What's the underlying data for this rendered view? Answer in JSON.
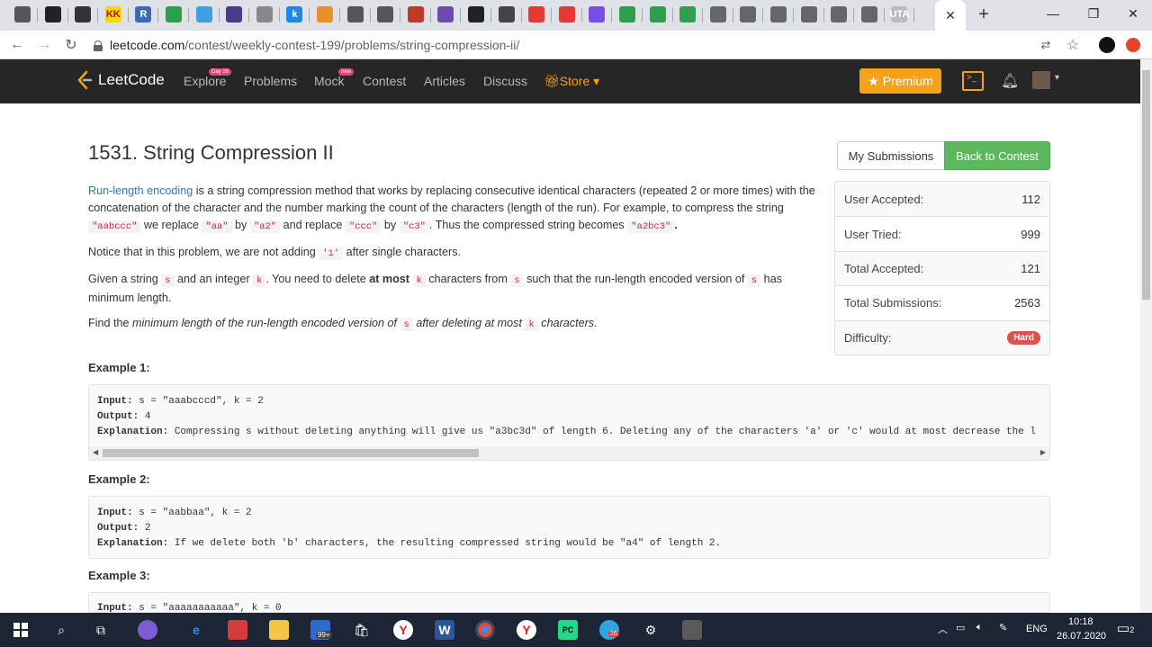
{
  "browser": {
    "tabs": [
      {
        "icon": "reader-icon",
        "label": ""
      },
      {
        "icon": "notion-icon",
        "label": ""
      },
      {
        "icon": "bow-tie-icon",
        "label": ""
      },
      {
        "icon": "kk-icon",
        "label": "KK"
      },
      {
        "icon": "r-icon",
        "label": "R"
      },
      {
        "icon": "check-circle-icon",
        "label": ""
      },
      {
        "icon": "cube-icon",
        "label": ""
      },
      {
        "icon": "hash-icon",
        "label": ""
      },
      {
        "icon": "compass-icon",
        "label": ""
      },
      {
        "icon": "k-icon",
        "label": "k"
      },
      {
        "icon": "chart-icon",
        "label": ""
      },
      {
        "icon": "globe-icon",
        "label": ""
      },
      {
        "icon": "globe-icon",
        "label": ""
      },
      {
        "icon": "image-icon",
        "label": ""
      },
      {
        "icon": "puzzle-icon",
        "label": ""
      },
      {
        "icon": "github-icon",
        "label": ""
      },
      {
        "icon": "t-circle-icon",
        "label": ""
      },
      {
        "icon": "red-box-icon",
        "label": ""
      },
      {
        "icon": "red-box-icon",
        "label": ""
      },
      {
        "icon": "kotlin-icon",
        "label": ""
      },
      {
        "icon": "q-icon",
        "label": ""
      },
      {
        "icon": "q-icon",
        "label": ""
      },
      {
        "icon": "q-icon",
        "label": ""
      },
      {
        "icon": "globe-icon",
        "label": ""
      },
      {
        "icon": "globe-icon",
        "label": ""
      },
      {
        "icon": "globe-icon",
        "label": ""
      },
      {
        "icon": "globe-icon",
        "label": ""
      },
      {
        "icon": "globe-icon",
        "label": ""
      },
      {
        "icon": "globe-icon",
        "label": ""
      },
      {
        "icon": "uta-icon",
        "label": "UTA"
      }
    ],
    "active_tab_close": "✕",
    "new_tab": "+",
    "url_host": "leetcode.com",
    "url_path": "/contest/weekly-contest-199/problems/string-compression-ii/"
  },
  "nav": {
    "logo": "LeetCode",
    "items": [
      {
        "label": "Explore",
        "badge": "Day 26"
      },
      {
        "label": "Problems",
        "badge": ""
      },
      {
        "label": "Mock",
        "badge": "new"
      },
      {
        "label": "Contest",
        "badge": ""
      },
      {
        "label": "Articles",
        "badge": ""
      },
      {
        "label": "Discuss",
        "badge": ""
      }
    ],
    "store": "Store",
    "premium": "Premium"
  },
  "problem": {
    "title": "1531. String Compression II",
    "p1": {
      "link": "Run-length encoding",
      "t1": " is a string compression method that works by replacing consecutive identical characters (repeated 2 or more times) with the concatenation of the character and the number marking the count of the characters (length of the run). For example, to compress the string ",
      "c1": "\"aabccc\"",
      "t2": " we replace ",
      "c2": "\"aa\"",
      "t3": " by ",
      "c3": "\"a2\"",
      "t4": " and replace ",
      "c4": "\"ccc\"",
      "t5": " by ",
      "c5": "\"c3\"",
      "t6": ". Thus the compressed string becomes ",
      "c6": "\"a2bc3\"",
      "t7": "."
    },
    "p2": {
      "t1": "Notice that in this problem, we are not adding ",
      "c1": "'1'",
      "t2": " after single characters."
    },
    "p3": {
      "t1": "Given a string ",
      "c1": "s",
      "t2": " and an integer ",
      "c2": "k",
      "t3": ". You need to delete ",
      "b1": "at most",
      "t4": " ",
      "c3": "k",
      "t5": " characters from ",
      "c4": "s",
      "t6": " such that the run-length encoded version of ",
      "c5": "s",
      "t7": " has minimum length."
    },
    "p4": {
      "t1": "Find the ",
      "i1": "minimum length of the run-length encoded version of ",
      "c1": "s",
      "i2": " after deleting at most ",
      "c2": "k",
      "i3": " characters."
    }
  },
  "sidebar": {
    "my_submissions": "My Submissions",
    "back_to_contest": "Back to Contest",
    "stats": [
      {
        "label": "User Accepted:",
        "value": "112"
      },
      {
        "label": "User Tried:",
        "value": "999"
      },
      {
        "label": "Total Accepted:",
        "value": "121"
      },
      {
        "label": "Total Submissions:",
        "value": "2563"
      }
    ],
    "difficulty_label": "Difficulty:",
    "difficulty_value": "Hard"
  },
  "examples": [
    {
      "heading": "Example 1:",
      "input_label": "Input:",
      "input": " s = \"aaabcccd\", k = 2",
      "output_label": "Output:",
      "output": " 4",
      "expl_label": "Explanation:",
      "expl": " Compressing s without deleting anything will give us \"a3bc3d\" of length 6. Deleting any of the characters 'a' or 'c' would at most decrease the l"
    },
    {
      "heading": "Example 2:",
      "input_label": "Input:",
      "input": " s = \"aabbaa\", k = 2",
      "output_label": "Output:",
      "output": " 2",
      "expl_label": "Explanation:",
      "expl": " If we delete both 'b' characters, the resulting compressed string would be \"a4\" of length 2."
    },
    {
      "heading": "Example 3:",
      "input_label": "Input:",
      "input": " s = \"aaaaaaaaaaa\", k = 0"
    }
  ],
  "taskbar": {
    "lang": "ENG",
    "time": "10:18",
    "date": "26.07.2020",
    "notif_count": "2",
    "store_badge": "99+",
    "telegram_badge": "26"
  },
  "colors": {
    "nav_bg": "#262626",
    "accent_green": "#5cb85c",
    "premium": "#f4a21a",
    "hard": "#d9534f",
    "link": "#2d77c7"
  }
}
